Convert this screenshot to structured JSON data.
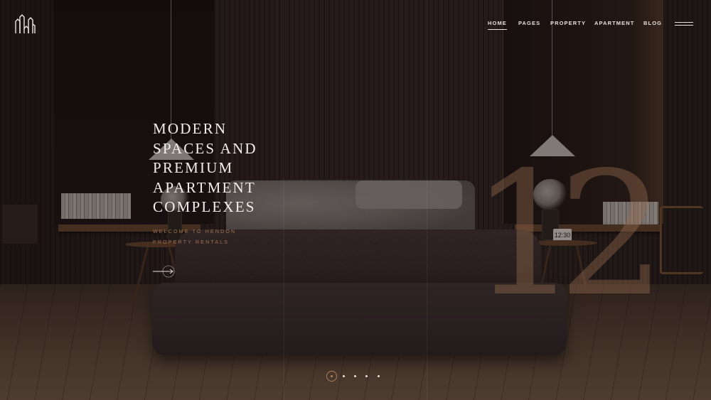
{
  "nav": {
    "items": [
      {
        "label": "HOME",
        "active": true
      },
      {
        "label": "PAGES",
        "active": false
      },
      {
        "label": "PROPERTY",
        "active": false
      },
      {
        "label": "APARTMENT",
        "active": false
      },
      {
        "label": "BLOG",
        "active": false
      }
    ],
    "menu_icon": "hamburger-menu-icon"
  },
  "logo": {
    "icon": "building-logo-icon"
  },
  "hero": {
    "headline_lines": [
      "MODERN",
      "SPACES AND",
      "PREMIUM",
      "APARTMENT",
      "COMPLEXES"
    ],
    "subtitle_lines": [
      "WELCOME TO HENDON",
      "PROPERTY RENTALS"
    ],
    "cta_icon": "arrow-right-icon",
    "slide_number": "12",
    "clock_display": "12:30"
  },
  "slider": {
    "slide_count": 5,
    "active_index": 0
  },
  "colors": {
    "accent": "#b0805c",
    "text": "#f2eeea",
    "subtitle": "#a0724f"
  }
}
